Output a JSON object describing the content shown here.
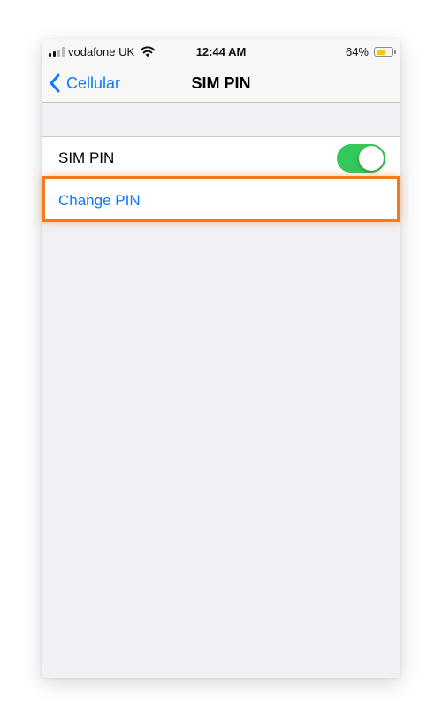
{
  "status_bar": {
    "carrier": "vodafone UK",
    "time": "12:44 AM",
    "battery_percent": "64%",
    "battery_level": 0.64,
    "signal_bars": 2,
    "signal_bars_total": 4,
    "wifi_icon": "wifi-icon",
    "battery_color": "#f5c518"
  },
  "nav": {
    "back_label": "Cellular",
    "back_icon": "chevron-left-icon",
    "title": "SIM PIN"
  },
  "settings": {
    "sim_pin": {
      "label": "SIM PIN",
      "enabled": true
    },
    "change_pin": {
      "label": "Change PIN",
      "highlighted": true
    }
  },
  "colors": {
    "accent": "#0a7aff",
    "toggle_on": "#34c759",
    "highlight": "#f47a20",
    "group_background": "#f0f0f5"
  }
}
